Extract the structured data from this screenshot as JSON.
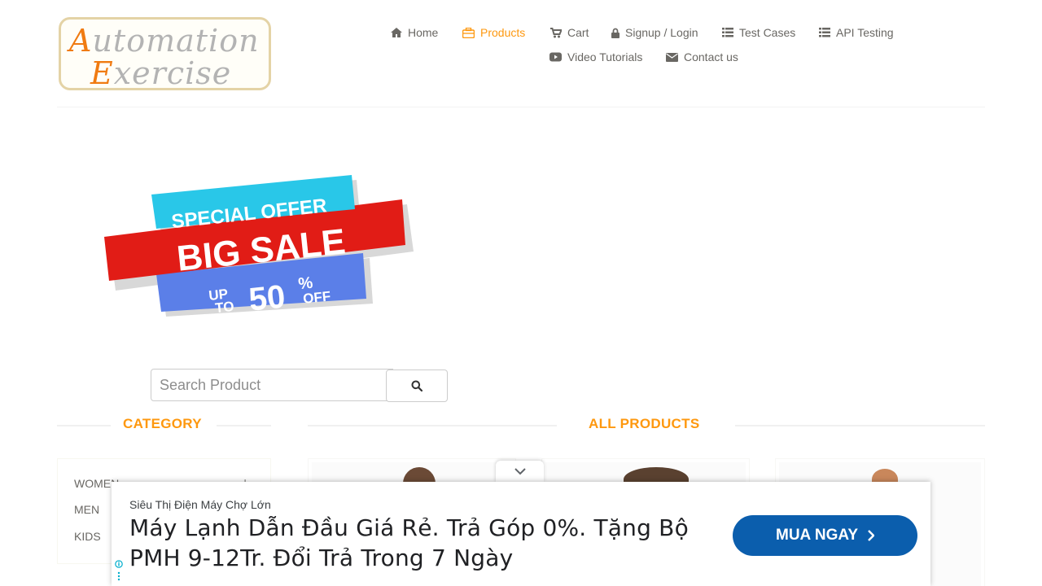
{
  "logo": {
    "line1_cap": "A",
    "line1_rest": "utomation",
    "line2_cap": "E",
    "line2_rest": "xercise"
  },
  "nav": [
    {
      "label": "Home",
      "icon": "home-icon"
    },
    {
      "label": "Products",
      "icon": "products-icon",
      "active": true
    },
    {
      "label": "Cart",
      "icon": "cart-icon"
    },
    {
      "label": "Signup / Login",
      "icon": "lock-icon"
    },
    {
      "label": "Test Cases",
      "icon": "list-icon"
    },
    {
      "label": "API Testing",
      "icon": "list-icon"
    },
    {
      "label": "Video Tutorials",
      "icon": "youtube-icon"
    },
    {
      "label": "Contact us",
      "icon": "envelope-icon"
    }
  ],
  "banner": {
    "line1": "SPECIAL OFFER",
    "line2": "BIG SALE",
    "up": "UP",
    "to": "TO",
    "percent": "50",
    "pct_sign": "%",
    "off": "OFF"
  },
  "search": {
    "placeholder": "Search Product",
    "value": ""
  },
  "sections": {
    "category": "CATEGORY",
    "all_products": "ALL PRODUCTS"
  },
  "categories": [
    {
      "label": "WOMEN"
    },
    {
      "label": "MEN"
    },
    {
      "label": "KIDS"
    }
  ],
  "ad": {
    "advertiser": "Siêu Thị Điện Máy Chợ Lớn",
    "headline": "Máy Lạnh Dẫn Đầu Giá Rẻ. Trả Góp 0%. Tặng Bộ PMH 9-12Tr. Đổi Trả Trong 7 Ngày",
    "cta": "MUA NGAY"
  },
  "colors": {
    "accent": "#fe980f",
    "text": "#696763",
    "ad_button": "#0b5ead",
    "sale_red": "#e11c16",
    "sale_blue": "#5b7fe8",
    "sale_cyan": "#29c7e8"
  }
}
